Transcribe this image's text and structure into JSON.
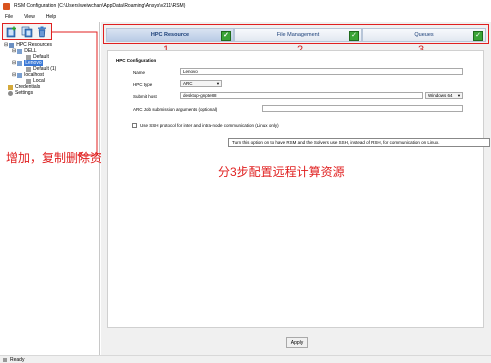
{
  "window": {
    "title": "RSM Configuration (C:\\Users\\weiwchan\\AppData\\Roaming\\Ansys\\v211\\RSM)"
  },
  "menu": [
    "File",
    "View",
    "Help"
  ],
  "toolbar": {
    "add_icon": "add-icon",
    "copy_icon": "copy-icon",
    "delete_icon": "delete-icon"
  },
  "tree": {
    "root": "HPC Resources",
    "items": [
      {
        "label": "DELL",
        "child": "Default"
      },
      {
        "label": "Lenovo",
        "child": "Default (1)"
      },
      {
        "label": "localhost",
        "child": "Local"
      }
    ],
    "credentials": "Credentials",
    "settings": "Settings"
  },
  "tabs": [
    {
      "label": "HPC Resource",
      "checked": true
    },
    {
      "label": "File Management",
      "checked": true
    },
    {
      "label": "Queues",
      "checked": true
    }
  ],
  "tab_numbers": [
    "1",
    "2",
    "3"
  ],
  "form": {
    "section": "HPC Configuration",
    "name_label": "Name",
    "name_value": "Lenovo",
    "type_label": "HPC type",
    "type_value": "ARC",
    "host_label": "Submit host",
    "host_value": "desktop-gnpte88",
    "os_value": "Windows 64",
    "args_label": "ARC Job submission arguments (optional)",
    "args_value": "",
    "ssh_label": "Use SSH protocol for inter and intra-node communication (Linux only)"
  },
  "tooltip": "Turn this option on to have RSM and the Solvers use SSH, instead of RSH, for communication on Linux.",
  "apply_label": "Apply",
  "status": "Ready",
  "annotations": {
    "left": "增加，复制删除资源配置",
    "center": "分3步配置远程计算资源"
  },
  "colors": {
    "annotation_red": "#e02020",
    "check_green": "#3aa336",
    "tab_text": "#1b3f78"
  }
}
